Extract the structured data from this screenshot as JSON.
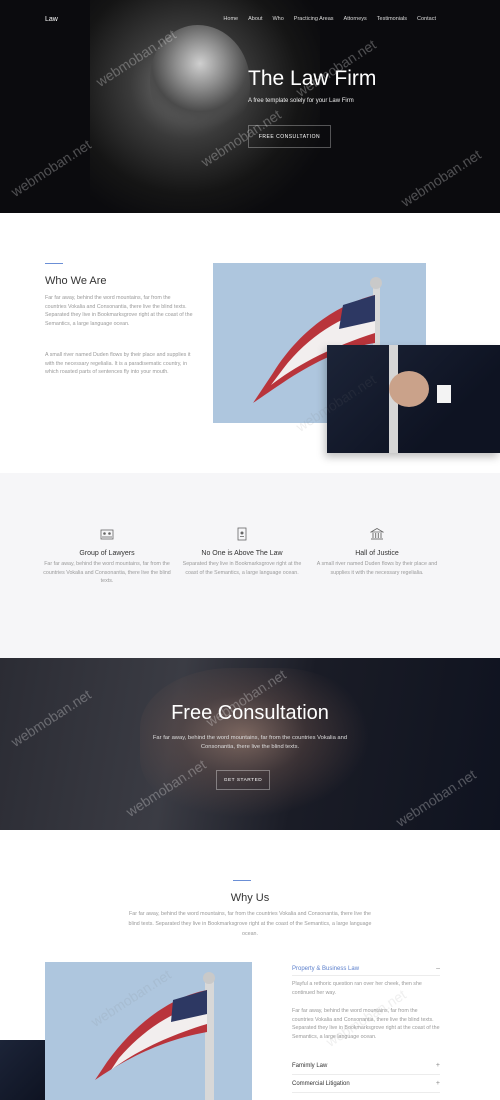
{
  "nav": {
    "logo": "Law",
    "items": [
      "Home",
      "About",
      "Who",
      "Practicing Areas",
      "Attorneys",
      "Testimonials",
      "Contact"
    ]
  },
  "hero": {
    "title": "The Law Firm",
    "subtitle": "A free template solely for your Law Firm",
    "button": "FREE CONSULTATION"
  },
  "who": {
    "title": "Who We Are",
    "p1": "Far far away, behind the word mountains, far from the countries Vokalia and Consonantia, there live the blind texts. Separated they live in Bookmarksgrove right at the coast of the Semantics, a large language ocean.",
    "p2": "A small river named Duden flows by their place and supplies it with the necessary regelialia. It is a paradisematic country, in which roasted parts of sentences fly into your mouth."
  },
  "features": [
    {
      "icon": "people-icon",
      "title": "Group of Lawyers",
      "text": "Far far away, behind the word mountains, far from the countries Vokalia and Consonantia, there live the blind texts."
    },
    {
      "icon": "document-icon",
      "title": "No One is Above The Law",
      "text": "Separated they live in Bookmarksgrove right at the coast of the Semantics, a large language ocean."
    },
    {
      "icon": "courthouse-icon",
      "title": "Hall of Justice",
      "text": "A small river named Duden flows by their place and supplies it with the necessary regelialia."
    }
  ],
  "consult": {
    "title": "Free Consultation",
    "subtitle": "Far far away, behind the word mountains, far from the countries Vokalia and Consonantia, there live the blind texts.",
    "button": "GET STARTED"
  },
  "why": {
    "title": "Why Us",
    "text": "Far far away, behind the word mountains, far from the countries Vokalia and Consonantia, there live the blind texts. Separated they live in Bookmarksgrove right at the coast of the Semantics, a large language ocean.",
    "accordion": [
      {
        "label": "Property & Business Law",
        "sign": "–",
        "open": true,
        "p1": "Playful a rethoric question ran over her cheek, then she continued her way.",
        "p2": "Far far away, behind the word mountains, far from the countries Vokalia and Consonantia, there live the blind texts. Separated they live in Bookmarksgrove right at the coast of the Semantics, a large language ocean."
      },
      {
        "label": "Famimly Law",
        "sign": "+"
      },
      {
        "label": "Commercial Litigation",
        "sign": "+"
      }
    ]
  },
  "watermark": "webmoban.net",
  "colors": {
    "accent": "#5b7fcc",
    "dark_bg": "#0b0b0e",
    "light_bg": "#f6f6f8"
  }
}
